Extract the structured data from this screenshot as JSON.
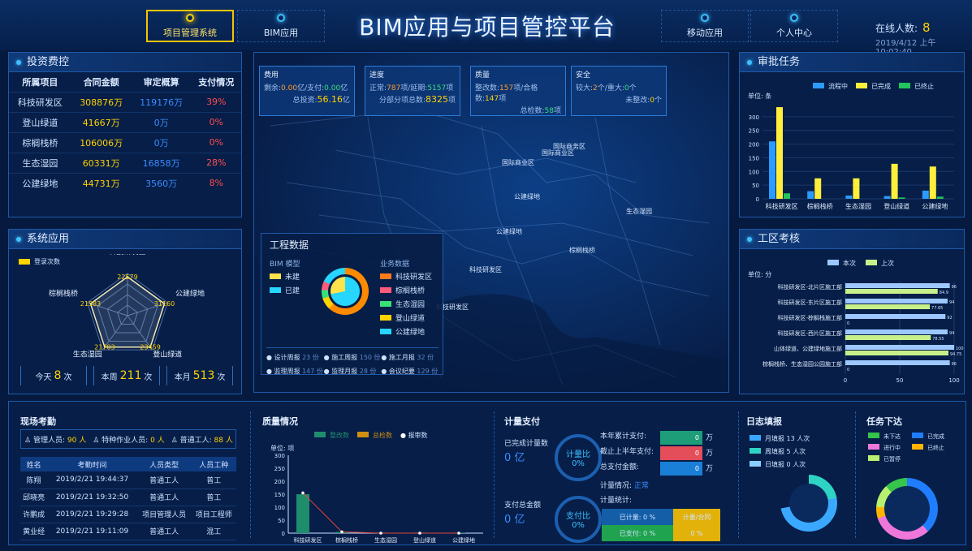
{
  "header": {
    "nav_left": [
      {
        "label": "项目管理系统",
        "active": true
      },
      {
        "label": "BIM应用",
        "active": false
      }
    ],
    "title": "BIM应用与项目管控平台",
    "nav_right": [
      {
        "label": "移动应用"
      },
      {
        "label": "个人中心"
      }
    ],
    "online_label": "在线人数:",
    "online_count": "8",
    "datetime": "2019/4/12 上午10:02:40"
  },
  "investment": {
    "title": "投资费控",
    "headers": [
      "所属项目",
      "合同金额",
      "审定概算",
      "支付情况"
    ],
    "rows": [
      [
        "科技研发区",
        "308876万",
        "119176万",
        "39%"
      ],
      [
        "登山绿道",
        "41667万",
        "0万",
        "0%"
      ],
      [
        "棕榈栈桥",
        "106006万",
        "0万",
        "0%"
      ],
      [
        "生态湿园",
        "60331万",
        "16858万",
        "28%"
      ],
      [
        "公建绿地",
        "44731万",
        "3560万",
        "8%"
      ]
    ]
  },
  "system": {
    "title": "系统应用",
    "legend": "登录次数",
    "radar_labels": [
      "科技研发区",
      "公建绿地",
      "登山绿道",
      "生态湿园",
      "棕榈栈桥"
    ],
    "radar_values": [
      "22579",
      "31160",
      "23459",
      "21703",
      "21583"
    ],
    "counters": [
      {
        "label": "今天",
        "value": "8",
        "unit": "次"
      },
      {
        "label": "本周",
        "value": "211",
        "unit": "次"
      },
      {
        "label": "本月",
        "value": "513",
        "unit": "次"
      }
    ]
  },
  "map": {
    "cards": [
      {
        "title": "费用",
        "rows": [
          [
            "剩余:",
            "0.00",
            "亿/支付:",
            "0.00",
            "亿"
          ],
          [
            "",
            "",
            "总投资:",
            "56.16",
            "亿"
          ]
        ]
      },
      {
        "title": "进度",
        "rows": [
          [
            "正常:",
            "787",
            "项/延期:",
            "5157",
            "项"
          ],
          [
            "",
            "",
            "分部分项总数:",
            "8325",
            "项"
          ]
        ]
      },
      {
        "title": "质量",
        "rows": [
          [
            "整改数:",
            "157",
            "项/合格数:",
            "147",
            "项"
          ],
          [
            "",
            "",
            "总检数:",
            "58",
            "项"
          ]
        ]
      },
      {
        "title": "安全",
        "rows": [
          [
            "较大:",
            "2",
            "个/重大:",
            "0",
            "个"
          ],
          [
            "",
            "",
            "未整改:",
            "0",
            "个"
          ]
        ]
      }
    ],
    "labels": [
      "国际商务区",
      "国际商业区",
      "国际商业区",
      "公建绿地",
      "生态湿园",
      "公建绿地",
      "棕榈栈桥",
      "科技研发区",
      "科技研发区"
    ]
  },
  "project": {
    "title": "工程数据",
    "bim_title": "BIM 模型",
    "bim_items": [
      "未建",
      "已建"
    ],
    "biz_title": "业务数据",
    "biz_items": [
      "科技研发区",
      "棕榈栈桥",
      "生态湿园",
      "登山绿道",
      "公建绿地"
    ],
    "reports": [
      [
        "设计周报",
        "23 份"
      ],
      [
        "施工周报",
        "150 份"
      ],
      [
        "施工月报",
        "32 份"
      ],
      [
        "监理周报",
        "147 份"
      ],
      [
        "监理月报",
        "28 份"
      ],
      [
        "会议纪要",
        "129 份"
      ]
    ]
  },
  "approval": {
    "title": "审批任务",
    "unit": "单位: 条",
    "legend": [
      "流程中",
      "已完成",
      "已终止"
    ],
    "chart_data": {
      "type": "bar",
      "categories": [
        "科技研发区",
        "棕榈栈桥",
        "生态湿园",
        "登山绿道",
        "公建绿地"
      ],
      "ylim": [
        0,
        350
      ],
      "yticks": [
        0,
        50,
        100,
        150,
        200,
        250,
        300
      ],
      "series": [
        {
          "name": "流程中",
          "values": [
            210,
            28,
            12,
            10,
            30
          ]
        },
        {
          "name": "已完成",
          "values": [
            335,
            75,
            75,
            128,
            118
          ]
        },
        {
          "name": "已终止",
          "values": [
            20,
            0,
            0,
            5,
            8
          ]
        }
      ]
    }
  },
  "assessment": {
    "title": "工区考核",
    "unit": "单位: 分",
    "legend": [
      "本次",
      "上次"
    ],
    "chart_data": {
      "type": "bar",
      "categories": [
        "科技研发区-北片区施工部",
        "科技研发区-东片区施工部",
        "科技研发区-棕榈栈施工部",
        "科技研发区-西片区施工部",
        "山体绿道、公建绿地施工部",
        "棕榈栈桥、生态湿园公园施工部"
      ],
      "xlim": [
        0,
        100
      ],
      "xticks": [
        "0",
        "50",
        "100"
      ],
      "series": [
        {
          "name": "本次",
          "values": [
            96,
            94,
            92,
            94,
            100,
            96
          ]
        },
        {
          "name": "上次",
          "values": [
            84.9,
            77.65,
            0,
            78.55,
            94.75,
            0
          ]
        }
      ]
    }
  },
  "attendance": {
    "title": "现场考勤",
    "summary": [
      [
        "管理人员:",
        "90 人"
      ],
      [
        "特种作业人员:",
        "0 人"
      ],
      [
        "普通工人:",
        "88 人"
      ]
    ],
    "headers": [
      "姓名",
      "考勤时间",
      "人员类型",
      "人员工种"
    ],
    "rows": [
      [
        "陈翔",
        "2019/2/21 19:44:37",
        "普通工人",
        "普工"
      ],
      [
        "邱晓亮",
        "2019/2/21 19:32:50",
        "普通工人",
        "普工"
      ],
      [
        "许鹏成",
        "2019/2/21 19:29:28",
        "项目管理人员",
        "项目工程师"
      ],
      [
        "黄业经",
        "2019/2/21 19:11:09",
        "普通工人",
        "混工"
      ]
    ]
  },
  "quality": {
    "title": "质量情况",
    "legend": [
      "整改数",
      "总检数",
      "报审数"
    ],
    "unit": "单位: 项",
    "chart_data": {
      "type": "bar",
      "categories": [
        "科技研发区",
        "棕榈栈桥",
        "生态湿园",
        "登山绿道",
        "公建绿地"
      ],
      "yticks": [
        0,
        50,
        100,
        150,
        200,
        250,
        300
      ],
      "series": [
        {
          "name": "整改数",
          "values": [
            150,
            5,
            2,
            2,
            2
          ]
        },
        {
          "name": "总检数",
          "values": [
            0,
            0,
            0,
            0,
            0
          ]
        },
        {
          "name": "报审数",
          "values": [
            155,
            5,
            0,
            0,
            0
          ]
        }
      ]
    }
  },
  "payment": {
    "title": "计量支付",
    "done_label": "已完成计量数",
    "done_val": "0 亿",
    "ratio1_label": "计量比",
    "ratio1_val": "0%",
    "paid_label": "支付总金额",
    "paid_val": "0 亿",
    "ratio2_label": "支付比",
    "ratio2_val": "0%",
    "items": [
      [
        "本年累计支付:",
        "0",
        "万"
      ],
      [
        "截止上半年支付:",
        "0",
        "万"
      ],
      [
        "总支付金额:",
        "0",
        "万"
      ]
    ],
    "status_label": "计量情况:",
    "status_val": "正常",
    "stats_label": "计量统计:",
    "stat_boxes": [
      "已计量: 0 %",
      "计量/合同",
      "已支付: 0 %",
      "0 %"
    ]
  },
  "log": {
    "title": "日志填报",
    "items": [
      "月填报 13 人次",
      "周填报 5 人次",
      "日填报 0 人次"
    ]
  },
  "tasks": {
    "title": "任务下达",
    "items": [
      "未下达",
      "已完成",
      "进行中",
      "已终止",
      "已暂停"
    ]
  }
}
